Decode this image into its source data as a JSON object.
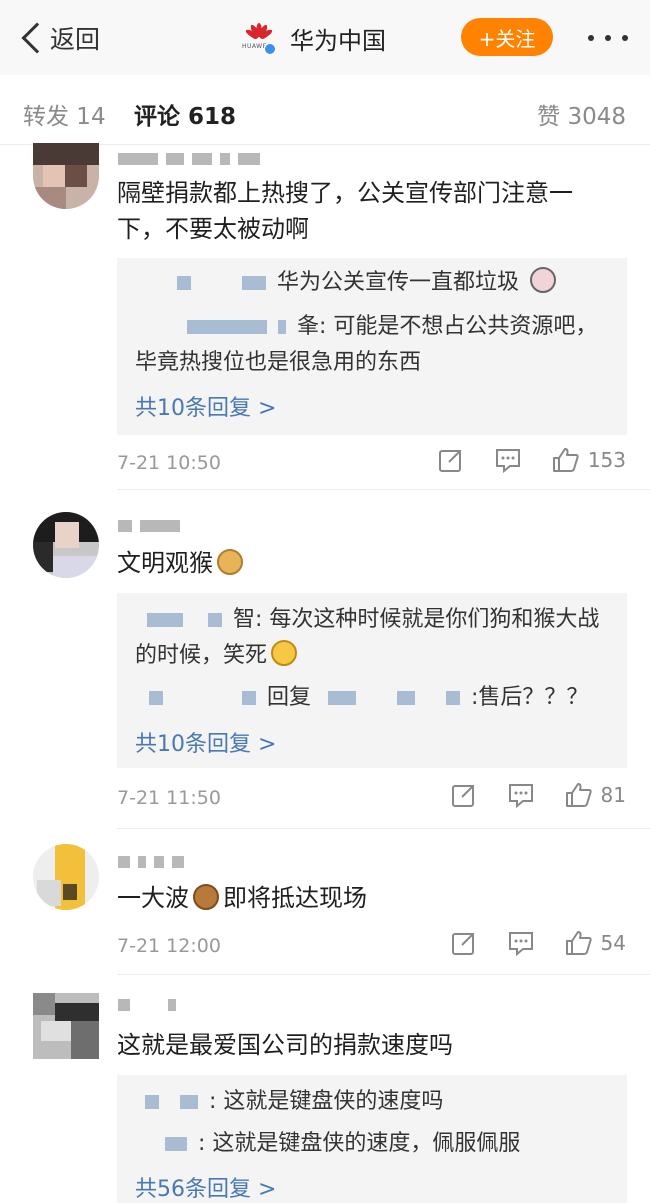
{
  "header": {
    "back_label": "返回",
    "account_name": "华为中国",
    "logo_text": "HUAWEI",
    "follow_label": "+关注"
  },
  "tabs": {
    "repost": "转发 14",
    "comments": "评论 618",
    "likes": "赞 3048"
  },
  "comments": [
    {
      "text": "隔壁捐款都上热搜了，公关宣传部门注意一下，不要太被动啊",
      "replies": [
        {
          "text": "华为公关宣传一直都垃圾"
        },
        {
          "text": "夆: 可能是不想占公共资源吧，",
          "text2": "毕竟热搜位也是很急用的东西"
        }
      ],
      "more_replies": "共10条回复 >",
      "time": "7-21 10:50",
      "like_count": "153"
    },
    {
      "text": "文明观猴",
      "replies": [
        {
          "text": "智: 每次这种时候就是你们狗和猴大战",
          "text2": "的时候，笑死"
        },
        {
          "text": "回复",
          "text2": ":售后？？？"
        }
      ],
      "more_replies": "共10条回复 >",
      "time": "7-21 11:50",
      "like_count": "81"
    },
    {
      "text_a": "一大波",
      "text_b": "即将抵达现场",
      "time": "7-21 12:00",
      "like_count": "54"
    },
    {
      "text": "这就是最爱国公司的捐款速度吗",
      "replies": [
        {
          "text": ": 这就是键盘侠的速度吗"
        },
        {
          "text": ": 这就是键盘侠的速度，佩服佩服"
        }
      ],
      "more_replies": "共56条回复 >"
    }
  ],
  "colors": {
    "accent_orange": "#ff8200",
    "link_blue": "#4a78b3",
    "huawei_red": "#d9262c"
  },
  "icons": [
    "back-chevron-icon",
    "huawei-logo-icon",
    "verified-badge-icon",
    "more-dots-icon",
    "share-icon",
    "comment-icon",
    "like-icon"
  ]
}
